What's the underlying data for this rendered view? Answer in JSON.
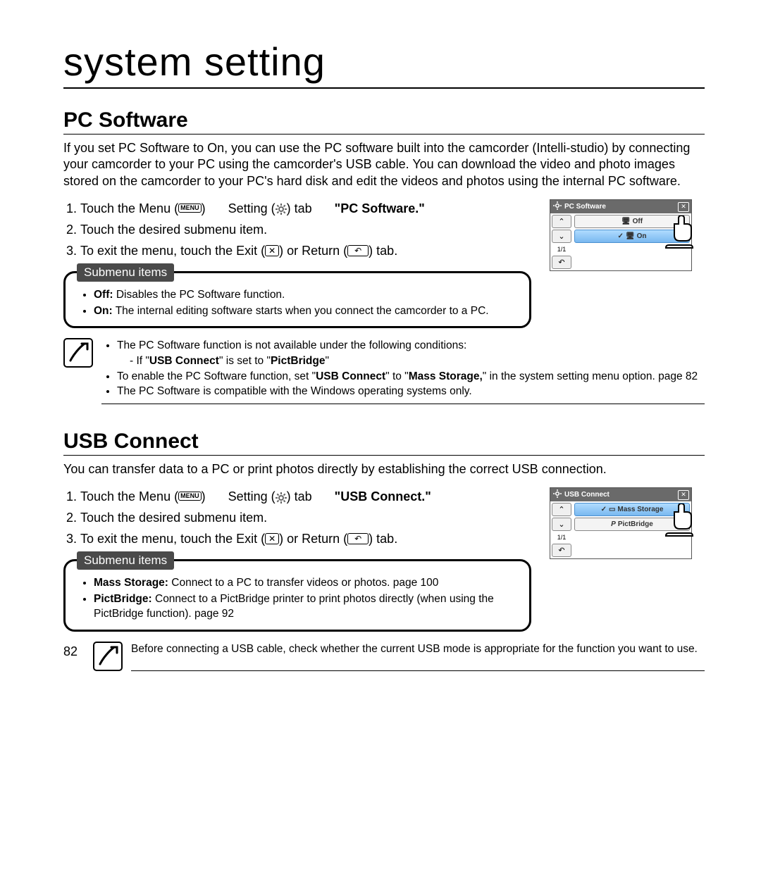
{
  "chapter_title": "system setting",
  "page_number": "82",
  "icons": {
    "menu_label": "MENU"
  },
  "pc_software": {
    "title": "PC Software",
    "intro": "If you set PC Software to On, you can use the PC software built into the camcorder (Intelli-studio) by connecting your camcorder to your PC using the camcorder's USB cable. You can download the video and photo images stored on the camcorder to your PC's hard disk and edit the videos and photos using the internal PC software.",
    "steps": {
      "s1_a": "Touch the Menu (",
      "s1_b": ") ",
      "s1_setting": " Setting (",
      "s1_c": ") tab ",
      "s1_target": "\"PC Software.\"",
      "s2": "Touch the desired submenu item.",
      "s3_a": "To exit the menu, touch the Exit (",
      "s3_b": ") or Return (",
      "s3_c": ") tab."
    },
    "submenu_label": "Submenu items",
    "submenu": {
      "off_label": "Off:",
      "off_desc": " Disables the PC Software function.",
      "on_label": "On:",
      "on_desc": " The internal editing software starts when you connect the camcorder to a PC."
    },
    "notes": {
      "n1": "The PC Software function is not available under the following conditions:",
      "n1a_pre": "If \"",
      "n1a_b1": "USB Connect",
      "n1a_mid": "\" is set to \"",
      "n1a_b2": "PictBridge",
      "n1a_post": "\"",
      "n2_pre": "To enable the PC Software function, set \"",
      "n2_b1": "USB Connect",
      "n2_mid": "\" to \"",
      "n2_b2": "Mass Storage,",
      "n2_post": "\" in the system setting menu option. ",
      "n2_page": "page 82",
      "n3": "The PC Software is compatible with the Windows operating systems only."
    },
    "screen": {
      "header": "PC Software",
      "opt_off": "Off",
      "opt_on": "On",
      "page": "1/1"
    }
  },
  "usb_connect": {
    "title": "USB Connect",
    "intro": "You can transfer data to a PC or print photos directly by establishing the correct USB connection.",
    "steps": {
      "s1_a": "Touch the Menu (",
      "s1_b": ") ",
      "s1_setting": " Setting (",
      "s1_c": ") tab ",
      "s1_target": "\"USB Connect.\"",
      "s2": "Touch the desired submenu item.",
      "s3_a": "To exit the menu, touch the Exit (",
      "s3_b": ") or Return (",
      "s3_c": ") tab."
    },
    "submenu_label": "Submenu items",
    "submenu": {
      "ms_label": "Mass Storage:",
      "ms_desc": " Connect to a PC to transfer videos or photos. ",
      "ms_page": "page 100",
      "pb_label": "PictBridge:",
      "pb_desc": " Connect to a PictBridge printer to print photos directly (when using the PictBridge function). ",
      "pb_page": "page 92"
    },
    "footer_note": "Before connecting a USB cable, check whether the current USB mode is appropriate for the function you want to use.",
    "screen": {
      "header": "USB Connect",
      "opt_ms": "Mass Storage",
      "opt_pb": "PictBridge",
      "page": "1/1"
    }
  }
}
